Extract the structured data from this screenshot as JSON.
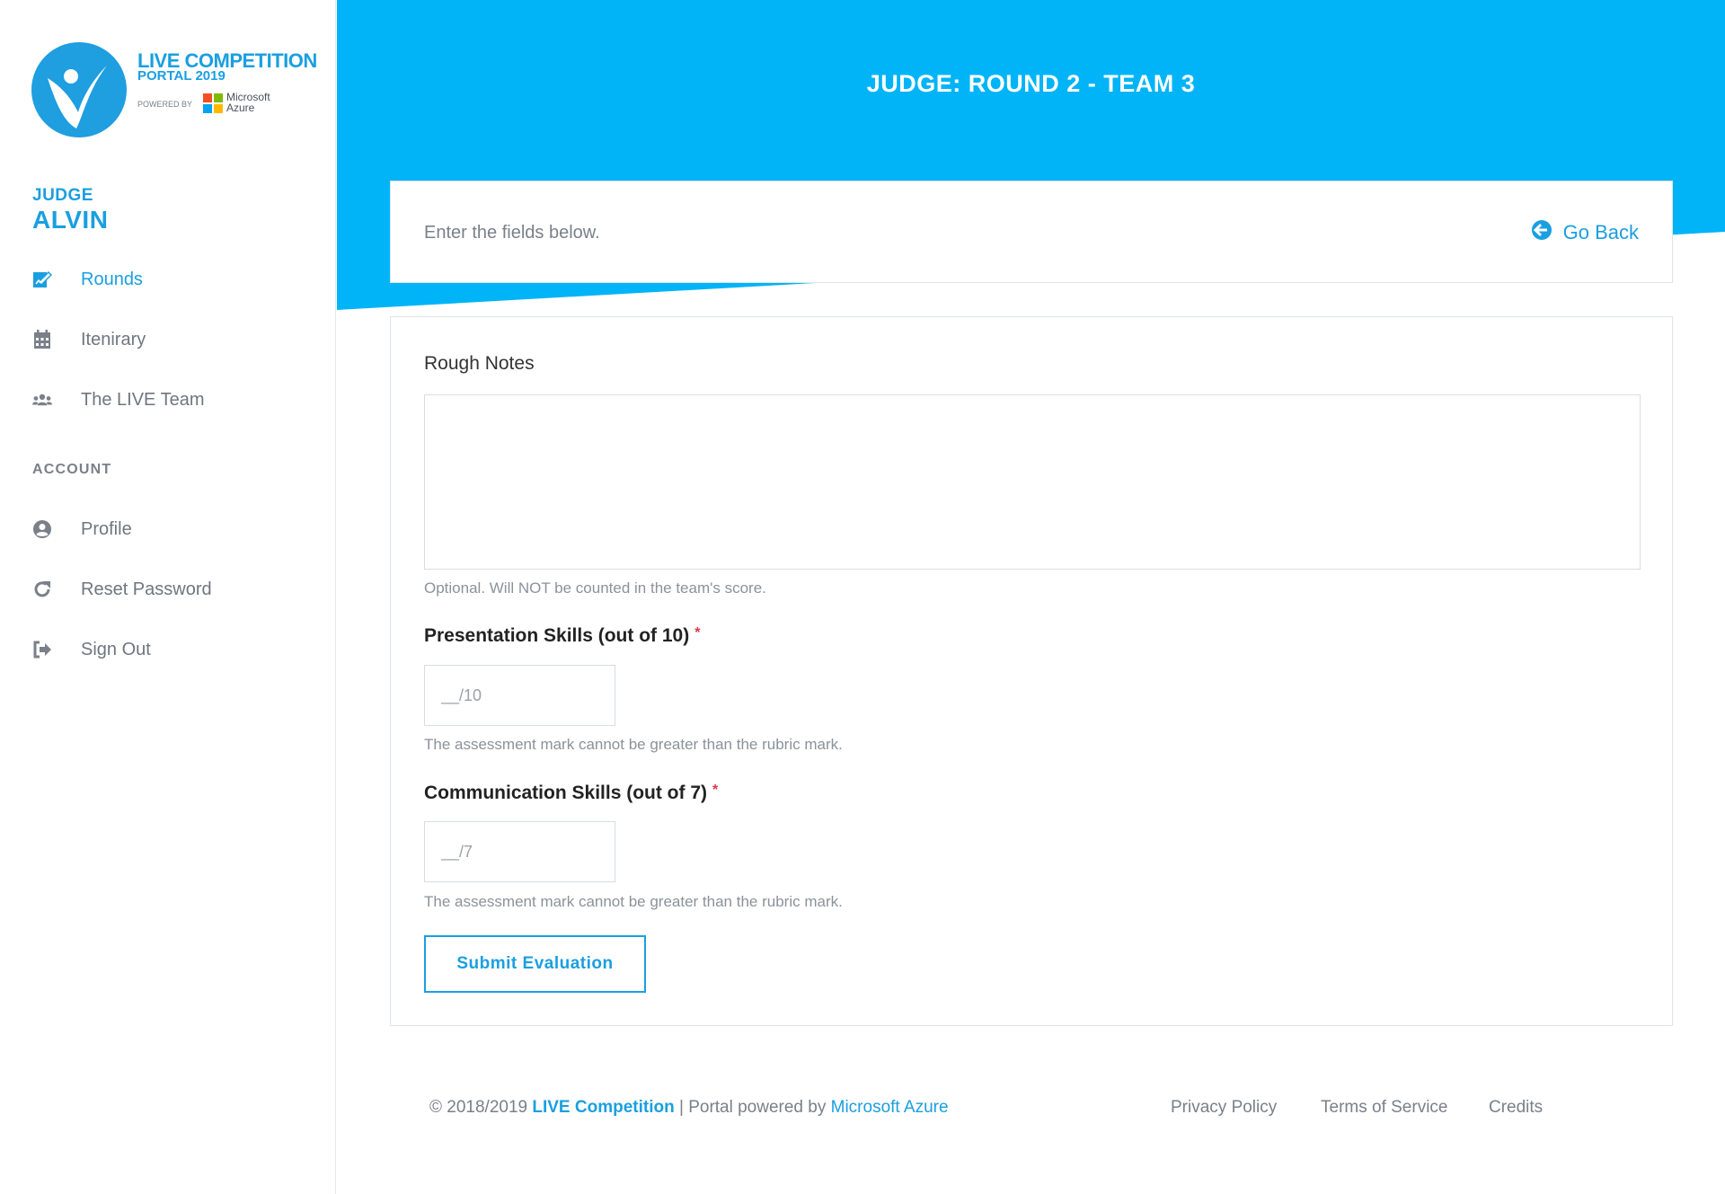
{
  "sidebar": {
    "logo": {
      "title": "LIVE COMPETITION",
      "subtitle": "PORTAL 2019",
      "powered_by": "POWERED BY",
      "ms_line1": "Microsoft",
      "ms_line2": "Azure"
    },
    "user": {
      "role": "JUDGE",
      "name": "ALVIN"
    },
    "nav": [
      {
        "label": "Rounds",
        "icon": "edit-icon",
        "active": true
      },
      {
        "label": "Itenirary",
        "icon": "calendar-icon"
      },
      {
        "label": "The LIVE Team",
        "icon": "users-icon"
      }
    ],
    "account_label": "ACCOUNT",
    "account": [
      {
        "label": "Profile",
        "icon": "user-circle-icon"
      },
      {
        "label": "Reset Password",
        "icon": "redo-icon"
      },
      {
        "label": "Sign Out",
        "icon": "sign-out-icon"
      }
    ]
  },
  "header": {
    "title": "JUDGE: ROUND 2 - TEAM 3",
    "color": "#00b4f7"
  },
  "top_card": {
    "intro": "Enter the fields below.",
    "go_back": "Go Back"
  },
  "form": {
    "notes_label": "Rough Notes",
    "notes_value": "",
    "notes_help": "Optional. Will NOT be counted in the team's score.",
    "presentation_label": "Presentation Skills (out of 10)",
    "presentation_placeholder": "__/10",
    "presentation_help": "The assessment mark cannot be greater than the rubric mark.",
    "communication_label": "Communication Skills (out of 7)",
    "communication_placeholder": "__/7",
    "communication_help": "The assessment mark cannot be greater than the rubric mark.",
    "required_mark": "*",
    "submit_label": "Submit Evaluation"
  },
  "footer": {
    "copyright": "© 2018/2019",
    "brand": "LIVE Competition",
    "separator": "| Portal powered by",
    "azure_link": "Microsoft Azure",
    "links": [
      "Privacy Policy",
      "Terms of Service",
      "Credits"
    ]
  },
  "colors": {
    "accent": "#1a9fe0",
    "header_blue": "#00b4f7",
    "required": "#e0344a"
  }
}
